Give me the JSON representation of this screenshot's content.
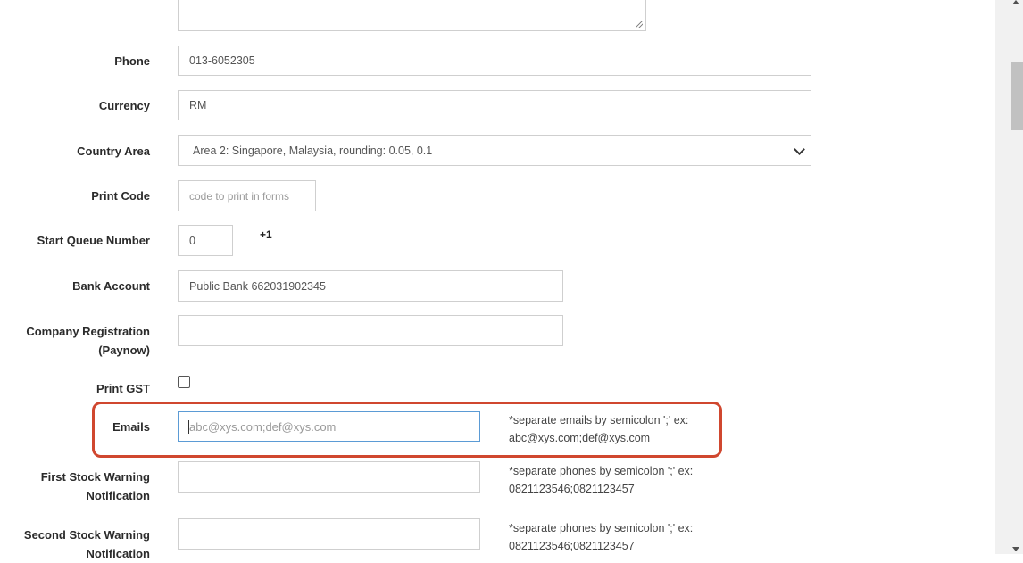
{
  "form": {
    "phone": {
      "label": "Phone",
      "value": "013-6052305"
    },
    "currency": {
      "label": "Currency",
      "value": "RM"
    },
    "country_area": {
      "label": "Country Area",
      "selected": "Area 2: Singapore, Malaysia, rounding: 0.05, 0.1"
    },
    "print_code": {
      "label": "Print Code",
      "placeholder": "code to print in forms"
    },
    "start_queue": {
      "label": "Start Queue Number",
      "value": "0",
      "increment": "+1"
    },
    "bank_account": {
      "label": "Bank Account",
      "value": "Public Bank 662031902345"
    },
    "company_registration": {
      "label_line1": "Company Registration",
      "label_line2": "(Paynow)",
      "value": ""
    },
    "print_gst": {
      "label": "Print GST",
      "checked": false
    },
    "emails": {
      "label": "Emails",
      "placeholder": "abc@xys.com;def@xys.com",
      "hint_line1": "*separate emails by semicolon ';' ex:",
      "hint_line2": "abc@xys.com;def@xys.com"
    },
    "first_stock_warning": {
      "label_line1": "First Stock Warning",
      "label_line2": "Notification",
      "hint_line1": "*separate phones by semicolon ';' ex:",
      "hint_line2": "0821123546;0821123457"
    },
    "second_stock_warning": {
      "label_line1": "Second Stock Warning",
      "label_line2": "Notification",
      "hint_line1": "*separate phones by semicolon ';' ex:",
      "hint_line2": "0821123546;0821123457"
    }
  },
  "colors": {
    "highlight": "#d0472f",
    "focus_border": "#5b9bd5"
  }
}
